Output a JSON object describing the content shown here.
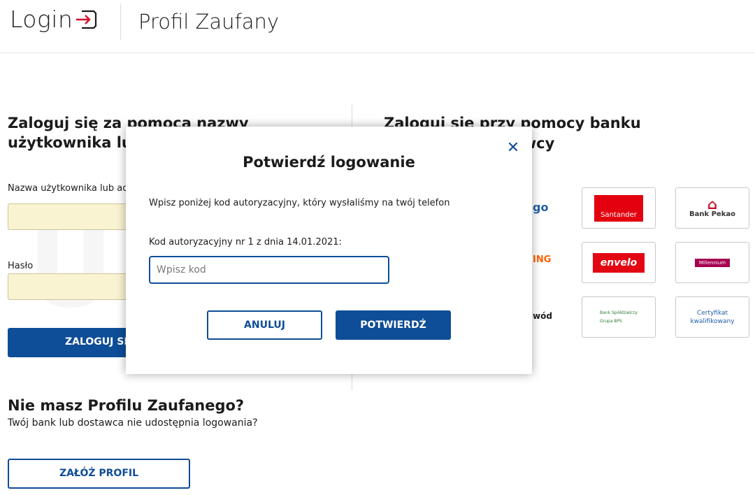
{
  "header": {
    "login_label": "Login",
    "title": "Profil Zaufany"
  },
  "left": {
    "heading": "Zaloguj się za pomocą nazwy użytkownika lub",
    "username_label": "Nazwa użytkownika lub ad",
    "password_label": "Hasło",
    "login_button": "ZALOGUJ SI"
  },
  "no_profile": {
    "heading": "Nie masz Profilu Zaufanego?",
    "text": "Twój bank lub dostawca nie udostępnia logowania?",
    "create_button": "ZAŁÓŻ PROFIL"
  },
  "right": {
    "heading": "Zaloguj się przy pomocy banku lub innego dostawcy",
    "banks": {
      "ipko_partial": "go",
      "ing_partial": "ING",
      "dowod_partial": "wód",
      "santander": "Santander",
      "pekao": "Bank Pekao",
      "envelo": "envelo",
      "millennium": "Millennium",
      "bps_line1": "Bank Spółdzielczy",
      "bps_line2": "Grupa BPS",
      "cert_line1": "Certyfikat",
      "cert_line2": "kwalifikowany"
    }
  },
  "modal": {
    "title": "Potwierdź logowanie",
    "description": "Wpisz poniżej kod autoryzacyjny, który wysłaliśmy na twój telefon",
    "code_label": "Kod autoryzacyjny nr 1 z dnia 14.01.2021:",
    "code_placeholder": "Wpisz kod",
    "cancel_button": "ANULUJ",
    "confirm_button": "POTWIERDŹ"
  },
  "watermark": "Ubinsir",
  "colors": {
    "primary": "#0e4d97",
    "field_bg": "#faf3d1",
    "santander": "#e3010f",
    "millennium": "#a6004f"
  }
}
